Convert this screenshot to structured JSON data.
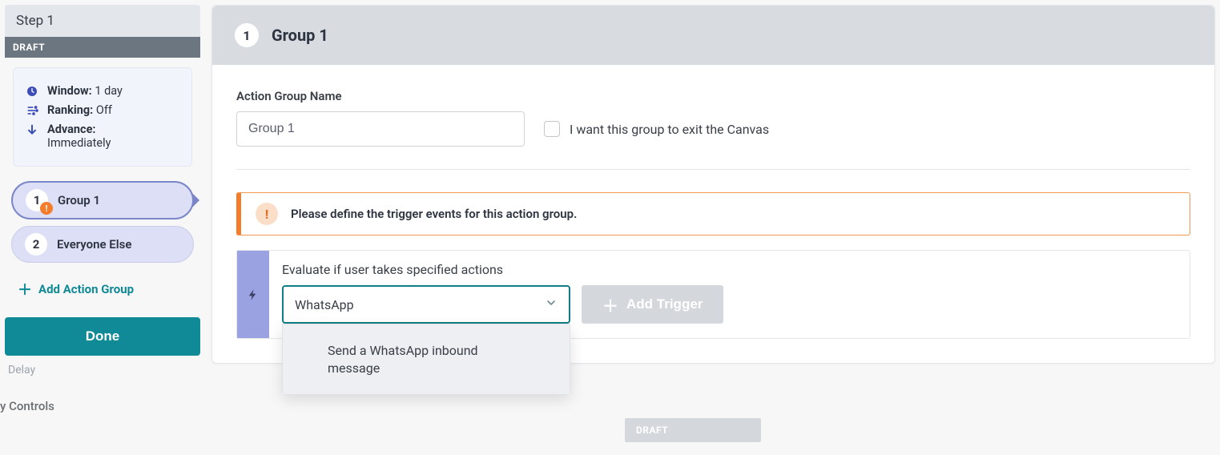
{
  "sidebar": {
    "step_title": "Step 1",
    "draft_badge": "DRAFT",
    "window_label": "Window:",
    "window_value": "1 day",
    "ranking_label": "Ranking:",
    "ranking_value": "Off",
    "advance_label": "Advance:",
    "advance_value": "Immediately",
    "groups": [
      {
        "num": "1",
        "label": "Group 1",
        "active": true,
        "has_warning": true
      },
      {
        "num": "2",
        "label": "Everyone Else",
        "active": false,
        "has_warning": false
      }
    ],
    "add_group_label": "Add Action Group",
    "done_label": "Done"
  },
  "background": {
    "delay_label": "Delay",
    "controls_label": "y Controls",
    "draft_behind": "DRAFT"
  },
  "main": {
    "header_num": "1",
    "header_title": "Group 1",
    "name_label": "Action Group Name",
    "name_value": "Group 1",
    "exit_checkbox_label": "I want this group to exit the Canvas",
    "alert_message": "Please define the trigger events for this action group.",
    "eval_label": "Evaluate if user takes specified actions",
    "trigger_select_value": "WhatsApp",
    "dropdown_option": "Send a WhatsApp inbound message",
    "add_trigger_label": "Add Trigger"
  }
}
